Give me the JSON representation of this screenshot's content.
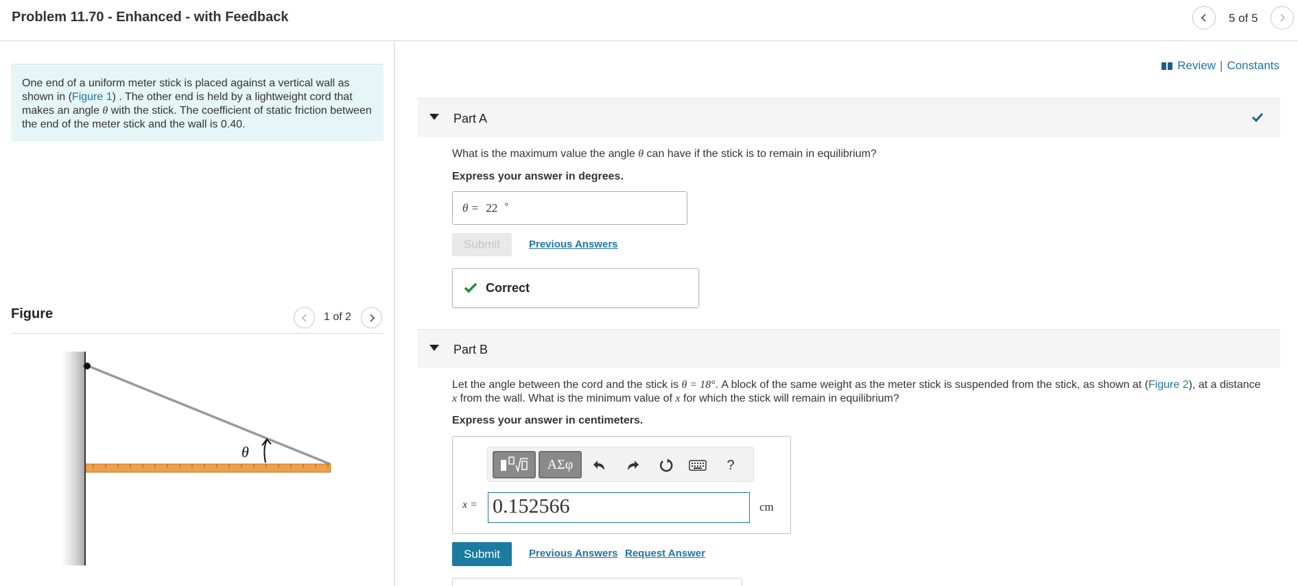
{
  "header": {
    "title": "Problem 11.70 - Enhanced - with Feedback",
    "pager": "5 of 5"
  },
  "problem": {
    "text_before_link": "One end of a uniform meter stick is placed against a vertical wall as shown in (",
    "link": "Figure 1",
    "text_after_link": ") . The other end is held by a lightweight cord that makes an angle ",
    "theta": "θ",
    "text_end": " with the stick. The coefficient of static friction between the end of the meter stick and the wall is 0.40."
  },
  "figure": {
    "label": "Figure",
    "pager": "1 of 2",
    "angle_label": "θ"
  },
  "review": {
    "review_label": "Review",
    "separator": "|",
    "constants_label": "Constants"
  },
  "partA": {
    "label": "Part A",
    "question_pre": "What is the maximum value the angle ",
    "theta": "θ",
    "question_post": " can have if the stick is to remain in equilibrium?",
    "instruction": "Express your answer in degrees.",
    "answer_var": "θ =",
    "answer_value": "22",
    "answer_unit": "°",
    "submit_label": "Submit",
    "previous_answers": "Previous Answers",
    "feedback": "Correct"
  },
  "partB": {
    "label": "Part B",
    "q_line1_pre": "Let the angle between the cord and the stick is ",
    "q_theta_eq": "θ = 18°",
    "q_line1_mid": ". A block of the same weight as the meter stick is suspended from the stick, as shown at (",
    "q_link": "Figure 2",
    "q_line1_post": "), at a distance",
    "q_x": "x",
    "q_line2_mid": " from the wall. What is the minimum value of ",
    "q_x2": "x",
    "q_line2_post": " for which the stick will remain in equilibrium?",
    "instruction": "Express your answer in centimeters.",
    "toolbar": {
      "templates_icon": "templates-sqrt-icon",
      "greek_label": "ΑΣφ",
      "undo_icon": "undo-icon",
      "redo_icon": "redo-icon",
      "reset_icon": "reset-icon",
      "keyboard_icon": "keyboard-icon",
      "help_label": "?"
    },
    "answer_var": "x =",
    "answer_value": "0.152566",
    "answer_unit": "cm",
    "submit_label": "Submit",
    "previous_answers": "Previous Answers",
    "request_answer": "Request Answer"
  },
  "colors": {
    "link": "#1b75a9",
    "correct_green": "#1e8c3a",
    "submit_blue": "#1b7ba0",
    "problem_bg": "#e6f5f5",
    "stick_orange": "#f0a04a"
  }
}
